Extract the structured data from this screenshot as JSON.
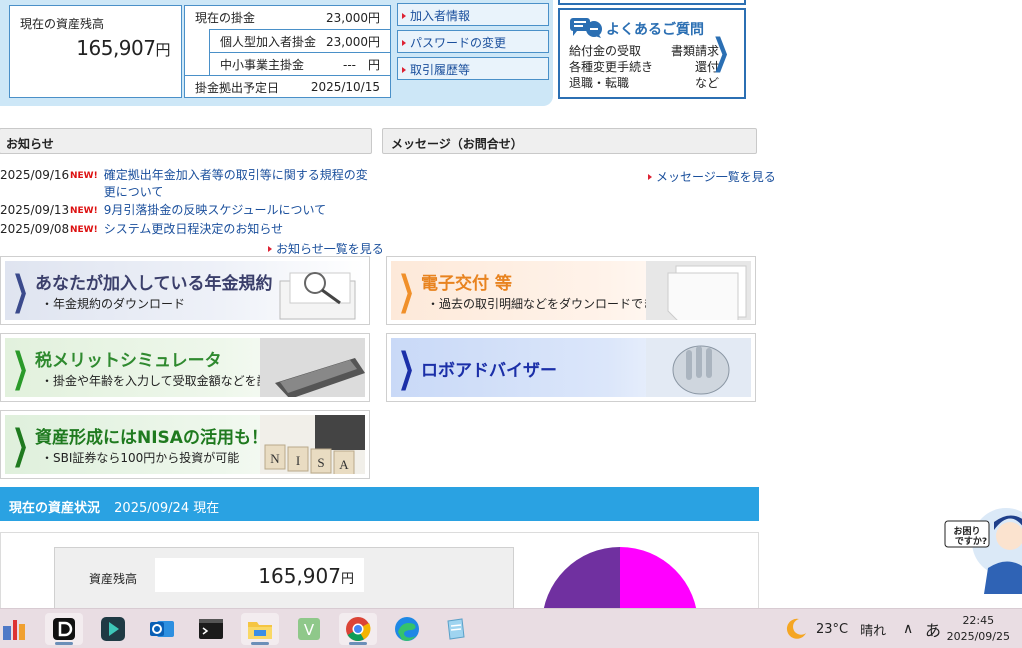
{
  "summary": {
    "balance_label": "現在の資産残高",
    "balance_value": "165,907",
    "balance_unit": "円",
    "current_contrib_label": "現在の掛金",
    "current_contrib_value": "23,000円",
    "individual_label": "個人型加入者掛金",
    "individual_value": "23,000円",
    "employer_label": "中小事業主掛金",
    "employer_value": "---　円",
    "due_label": "掛金拠出予定日",
    "due_value": "2025/10/15"
  },
  "menu": [
    "加入者情報",
    "パスワードの変更",
    "取引履歴等"
  ],
  "faq": {
    "title": "よくあるご質問",
    "rows": [
      [
        "給付金の受取",
        "書類請求"
      ],
      [
        "各種変更手続き",
        "還付"
      ],
      [
        "退職・転職",
        "など"
      ]
    ]
  },
  "notices": {
    "heading": "お知らせ",
    "items": [
      {
        "date": "2025/09/16",
        "badge": "NEW!",
        "title": "確定拠出年金加入者等の取引等に関する規程の変更について"
      },
      {
        "date": "2025/09/13",
        "badge": "NEW!",
        "title": "9月引落掛金の反映スケジュールについて"
      },
      {
        "date": "2025/09/08",
        "badge": "NEW!",
        "title": "システム更改日程決定のお知らせ"
      }
    ],
    "more": "お知らせ一覧を見る"
  },
  "messages": {
    "heading": "メッセージ（お問合せ）",
    "more": "メッセージ一覧を見る"
  },
  "banners": {
    "plan": {
      "title": "あなたが加入している年金規約",
      "sub": "・年金規約のダウンロード"
    },
    "edelivery": {
      "title": "電子交付 等",
      "sub": "・過去の取引明細などをダウンロードできます"
    },
    "tax": {
      "title": "税メリットシミュレータ",
      "sub": "・掛金や年齢を入力して受取金額などを試算"
    },
    "robo": {
      "title": "ロボアドバイザー"
    },
    "nisa": {
      "title": "資産形成にはNISAの活用も！",
      "sub": "・SBI証券なら100円から投資が可能",
      "tiles": [
        "N",
        "I",
        "S",
        "A"
      ]
    }
  },
  "status": {
    "heading": "現在の資産状況",
    "date": "2025/09/24 現在",
    "balance_label": "資産残高",
    "balance_value": "165,907",
    "balance_unit": "円"
  },
  "helper": {
    "text": "お困りですか?"
  },
  "taskbar": {
    "weather_temp": "23°C",
    "weather_cond": "晴れ",
    "ime": "あ",
    "time": "22:45",
    "date": "2025/09/25"
  },
  "colors": {
    "accent": "#2aa2e2",
    "link": "#1a4f9c",
    "new_badge": "#d11111",
    "pie_purple": "#7030a0",
    "pie_magenta": "#ff00ff"
  }
}
